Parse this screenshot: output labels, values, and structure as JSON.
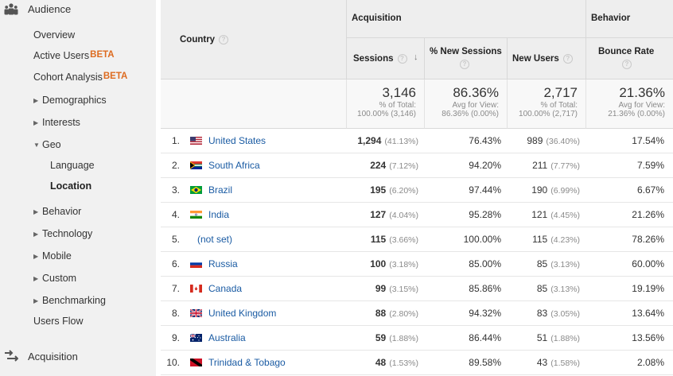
{
  "sidebar": {
    "sections": [
      {
        "label": "Audience",
        "icon": "audience-icon"
      },
      {
        "label": "Acquisition",
        "icon": "acquisition-icon"
      }
    ],
    "items": [
      {
        "label": "Overview"
      },
      {
        "label": "Active Users",
        "badge": "BETA"
      },
      {
        "label": "Cohort Analysis",
        "badge": "BETA"
      },
      {
        "label": "Demographics",
        "arrow": "▶"
      },
      {
        "label": "Interests",
        "arrow": "▶"
      },
      {
        "label": "Geo",
        "arrow": "▼"
      },
      {
        "label": "Behavior",
        "arrow": "▶"
      },
      {
        "label": "Technology",
        "arrow": "▶"
      },
      {
        "label": "Mobile",
        "arrow": "▶"
      },
      {
        "label": "Custom",
        "arrow": "▶"
      },
      {
        "label": "Benchmarking",
        "arrow": "▶"
      },
      {
        "label": "Users Flow"
      }
    ],
    "geo_sub": [
      {
        "label": "Language"
      },
      {
        "label": "Location"
      }
    ]
  },
  "table": {
    "country_header": "Country",
    "group_acquisition": "Acquisition",
    "group_behavior": "Behavior",
    "columns": {
      "sessions": "Sessions",
      "new_sessions": "% New Sessions",
      "new_users": "New Users",
      "bounce": "Bounce Rate"
    },
    "totals": {
      "sessions": {
        "value": "3,146",
        "line1": "% of Total:",
        "line2": "100.00% (3,146)"
      },
      "new_sessions": {
        "value": "86.36%",
        "line1": "Avg for View:",
        "line2": "86.36% (0.00%)"
      },
      "new_users": {
        "value": "2,717",
        "line1": "% of Total:",
        "line2": "100.00% (2,717)"
      },
      "bounce": {
        "value": "21.36%",
        "line1": "Avg for View:",
        "line2": "21.36% (0.00%)"
      }
    },
    "rows": [
      {
        "rank": "1.",
        "flag": "us",
        "country": "United States",
        "sessions": "1,294",
        "sessions_pct": "(41.13%)",
        "new_sessions": "76.43%",
        "new_users": "989",
        "new_users_pct": "(36.40%)",
        "bounce": "17.54%"
      },
      {
        "rank": "2.",
        "flag": "za",
        "country": "South Africa",
        "sessions": "224",
        "sessions_pct": "(7.12%)",
        "new_sessions": "94.20%",
        "new_users": "211",
        "new_users_pct": "(7.77%)",
        "bounce": "7.59%"
      },
      {
        "rank": "3.",
        "flag": "br",
        "country": "Brazil",
        "sessions": "195",
        "sessions_pct": "(6.20%)",
        "new_sessions": "97.44%",
        "new_users": "190",
        "new_users_pct": "(6.99%)",
        "bounce": "6.67%"
      },
      {
        "rank": "4.",
        "flag": "in",
        "country": "India",
        "sessions": "127",
        "sessions_pct": "(4.04%)",
        "new_sessions": "95.28%",
        "new_users": "121",
        "new_users_pct": "(4.45%)",
        "bounce": "21.26%"
      },
      {
        "rank": "5.",
        "flag": "",
        "country": "(not set)",
        "sessions": "115",
        "sessions_pct": "(3.66%)",
        "new_sessions": "100.00%",
        "new_users": "115",
        "new_users_pct": "(4.23%)",
        "bounce": "78.26%"
      },
      {
        "rank": "6.",
        "flag": "ru",
        "country": "Russia",
        "sessions": "100",
        "sessions_pct": "(3.18%)",
        "new_sessions": "85.00%",
        "new_users": "85",
        "new_users_pct": "(3.13%)",
        "bounce": "60.00%"
      },
      {
        "rank": "7.",
        "flag": "ca",
        "country": "Canada",
        "sessions": "99",
        "sessions_pct": "(3.15%)",
        "new_sessions": "85.86%",
        "new_users": "85",
        "new_users_pct": "(3.13%)",
        "bounce": "19.19%"
      },
      {
        "rank": "8.",
        "flag": "gb",
        "country": "United Kingdom",
        "sessions": "88",
        "sessions_pct": "(2.80%)",
        "new_sessions": "94.32%",
        "new_users": "83",
        "new_users_pct": "(3.05%)",
        "bounce": "13.64%"
      },
      {
        "rank": "9.",
        "flag": "au",
        "country": "Australia",
        "sessions": "59",
        "sessions_pct": "(1.88%)",
        "new_sessions": "86.44%",
        "new_users": "51",
        "new_users_pct": "(1.88%)",
        "bounce": "13.56%"
      },
      {
        "rank": "10.",
        "flag": "tt",
        "country": "Trinidad & Tobago",
        "sessions": "48",
        "sessions_pct": "(1.53%)",
        "new_sessions": "89.58%",
        "new_users": "43",
        "new_users_pct": "(1.58%)",
        "bounce": "2.08%"
      }
    ]
  },
  "colors": {
    "link": "#1a5ba3",
    "beta": "#dd6b20",
    "sidebar_bg": "#f1f1f1",
    "header_bg": "#eeeeee"
  }
}
